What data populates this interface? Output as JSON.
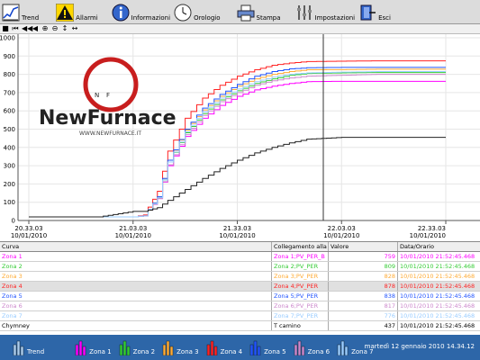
{
  "menubar": {
    "items": [
      {
        "label": "Trend",
        "icon": "trend-icon"
      },
      {
        "label": "Allarmi",
        "icon": "alarm-icon"
      },
      {
        "label": "Informazioni",
        "icon": "info-icon"
      },
      {
        "label": "Orologio",
        "icon": "clock-icon"
      },
      {
        "label": "Stampa",
        "icon": "printer-icon"
      },
      {
        "label": "Impostazioni",
        "icon": "settings-icon"
      },
      {
        "label": "Esci",
        "icon": "exit-icon"
      }
    ]
  },
  "toolbar": {
    "buttons": [
      "stop-icon",
      "first-icon",
      "rewind-icon",
      "prev-icon",
      "zoom-in-icon",
      "zoom-out-icon",
      "fit-vertical-icon",
      "fit-horizontal-icon"
    ]
  },
  "logo": {
    "text": "NewFurnace",
    "url": "WWW.NEWFURNACE.IT"
  },
  "chart_data": {
    "type": "line",
    "ylim": [
      0,
      1000
    ],
    "yticks": [
      "0",
      "100",
      "200",
      "300",
      "400",
      "500",
      "600",
      "700",
      "800",
      "900",
      "1000"
    ],
    "xticks": [
      {
        "time": "20.33.03",
        "date": "10/01/2010"
      },
      {
        "time": "21.03.03",
        "date": "10/01/2010"
      },
      {
        "time": "21.33.03",
        "date": "10/01/2010"
      },
      {
        "time": "22.03.03",
        "date": "10/01/2010"
      },
      {
        "time": "22.33.03",
        "date": "10/01/2010"
      }
    ],
    "cursor_time": "21.50",
    "x_minutes": [
      0,
      20,
      30,
      33,
      37,
      40,
      45,
      50,
      55,
      60,
      65,
      70,
      75,
      80,
      90,
      100,
      110,
      120
    ],
    "series": [
      {
        "name": "Zona 1",
        "color": "#ff00ff",
        "values": [
          20,
          20,
          20,
          25,
          120,
          300,
          460,
          560,
          630,
          680,
          715,
          735,
          750,
          760,
          762,
          762,
          762,
          762
        ]
      },
      {
        "name": "Zona 2",
        "color": "#33cc33",
        "values": [
          20,
          20,
          20,
          25,
          125,
          320,
          480,
          585,
          660,
          710,
          750,
          775,
          795,
          805,
          808,
          810,
          810,
          810
        ]
      },
      {
        "name": "Zona 3",
        "color": "#ffaa33",
        "values": [
          20,
          20,
          20,
          25,
          130,
          330,
          495,
          605,
          680,
          735,
          775,
          800,
          815,
          825,
          826,
          828,
          828,
          828
        ]
      },
      {
        "name": "Zona 4",
        "color": "#ff2222",
        "values": [
          20,
          20,
          20,
          30,
          160,
          380,
          560,
          670,
          740,
          790,
          825,
          850,
          862,
          870,
          872,
          874,
          874,
          874
        ]
      },
      {
        "name": "Zona 5",
        "color": "#2255ff",
        "values": [
          20,
          20,
          20,
          25,
          130,
          330,
          500,
          615,
          690,
          745,
          790,
          815,
          830,
          836,
          838,
          838,
          838,
          838
        ]
      },
      {
        "name": "Zona 6",
        "color": "#cc88cc",
        "values": [
          20,
          20,
          20,
          25,
          120,
          305,
          470,
          575,
          650,
          700,
          740,
          765,
          780,
          790,
          795,
          800,
          800,
          800
        ]
      },
      {
        "name": "Zona 7",
        "color": "#99ccff",
        "values": [
          20,
          20,
          20,
          25,
          125,
          320,
          485,
          595,
          670,
          720,
          760,
          785,
          800,
          808,
          812,
          815,
          815,
          815
        ]
      },
      {
        "name": "Chymney",
        "color": "#222222",
        "values": [
          20,
          20,
          50,
          50,
          70,
          110,
          170,
          230,
          285,
          330,
          370,
          400,
          425,
          445,
          455,
          455,
          455,
          455
        ]
      }
    ]
  },
  "table": {
    "headers": {
      "curve": "Curva",
      "link": "Collegamento alla va",
      "value": "Valore",
      "date": "Data/Orario"
    },
    "rows": [
      {
        "curve": "Zona 1",
        "link": "Zona 1;PV_PER_B",
        "value": "759",
        "date": "10/01/2010 21:52:45.468",
        "color": "#ff00ff"
      },
      {
        "curve": "Zona 2",
        "link": "Zona 2;PV_PER",
        "value": "809",
        "date": "10/01/2010 21:52:45.468",
        "color": "#33cc33"
      },
      {
        "curve": "Zona 3",
        "link": "Zona 3;PV_PER",
        "value": "828",
        "date": "10/01/2010 21:52:45.468",
        "color": "#ffaa33"
      },
      {
        "curve": "Zona 4",
        "link": "Zona 4;PV_PER",
        "value": "878",
        "date": "10/01/2010 21:52:45.468",
        "color": "#ff2222"
      },
      {
        "curve": "Zona 5",
        "link": "Zona 5;PV_PER",
        "value": "838",
        "date": "10/01/2010 21:52:45.468",
        "color": "#2255ff"
      },
      {
        "curve": "Zona 6",
        "link": "Zona 6;PV_PER",
        "value": "817",
        "date": "10/01/2010 21:52:45.468",
        "color": "#cc88cc"
      },
      {
        "curve": "Zona 7",
        "link": "Zona 7;PV_PER",
        "value": "776",
        "date": "10/01/2010 21:52:45.468",
        "color": "#99ccff"
      },
      {
        "curve": "Chymney",
        "link": "T camino",
        "value": "437",
        "date": "10/01/2010 21:52:45.468",
        "color": "#000000"
      }
    ]
  },
  "taskbar": {
    "items": [
      {
        "label": "Trend"
      },
      {
        "label": "Zona 1"
      },
      {
        "label": "Zona 2"
      },
      {
        "label": "Zona 3"
      },
      {
        "label": "Zona 4"
      },
      {
        "label": "Zona 5"
      },
      {
        "label": "Zona 6"
      },
      {
        "label": "Zona 7"
      }
    ],
    "clock": "martedì 12 gennaio 2010 14.34.12"
  }
}
